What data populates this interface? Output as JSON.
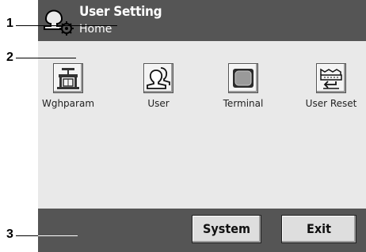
{
  "header": {
    "title": "User Setting",
    "subtitle": "Home"
  },
  "tiles": [
    {
      "label": "Wghparam"
    },
    {
      "label": "User"
    },
    {
      "label": "Terminal"
    },
    {
      "label": "User Reset"
    }
  ],
  "footer": {
    "system_label": "System",
    "exit_label": "Exit"
  },
  "callouts": [
    "1",
    "2",
    "3"
  ],
  "colors": {
    "header_bg": "#555555",
    "content_bg": "#e9e9e9",
    "button_bg": "#dedede"
  }
}
